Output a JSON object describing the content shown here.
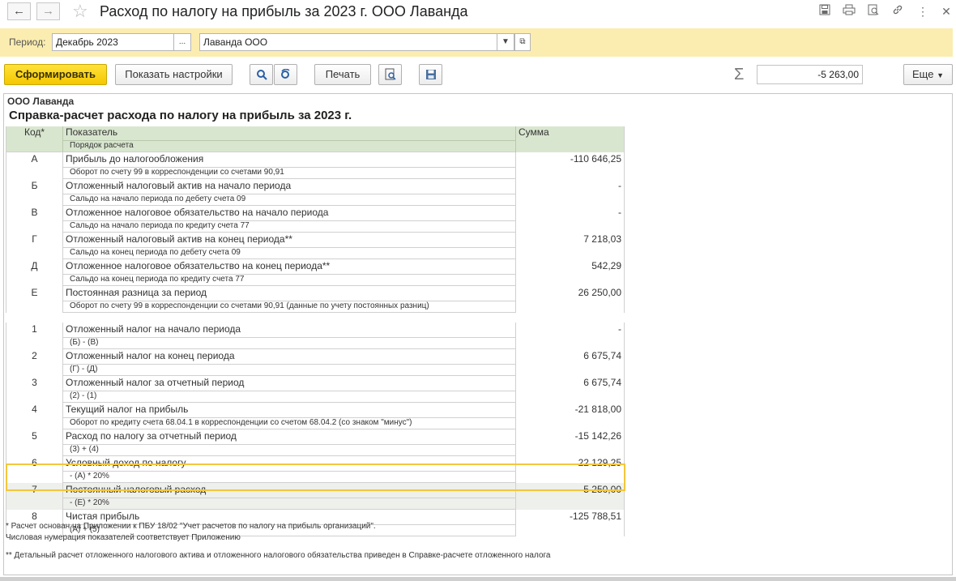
{
  "window": {
    "title": "Расход по налогу на прибыль за 2023 г. ООО Лаванда",
    "back_icon": "arrow-left-icon",
    "forward_icon": "arrow-right-icon",
    "favorite_icon": "star-icon"
  },
  "filters": {
    "period_label": "Период:",
    "period_value": "Декабрь 2023",
    "period_picker": "...",
    "org_value": "Лаванда ООО"
  },
  "toolbar": {
    "generate_label": "Сформировать",
    "settings_label": "Показать настройки",
    "print_label": "Печать",
    "more_label": "Еще",
    "sum_value": "-5 263,00"
  },
  "report": {
    "org": "ООО Лаванда",
    "title": "Справка-расчет расхода по налогу на прибыль за 2023 г.",
    "headers": {
      "code": "Код*",
      "indicator": "Показатель",
      "order": "Порядок расчета",
      "sum": "Сумма"
    },
    "rows": [
      {
        "code": "А",
        "name": "Прибыль до налогообложения",
        "desc": "Оборот по счету 99 в корреспонденции со счетами 90,91",
        "sum": "-110 646,25"
      },
      {
        "code": "Б",
        "name": "Отложенный налоговый актив на начало периода",
        "desc": "Сальдо на начало периода по дебету счета 09",
        "sum": "-"
      },
      {
        "code": "В",
        "name": "Отложенное налоговое обязательство на начало периода",
        "desc": "Сальдо на начало периода по кредиту счета 77",
        "sum": "-"
      },
      {
        "code": "Г",
        "name": "Отложенный налоговый актив на конец периода**",
        "desc": "Сальдо на конец периода по дебету счета 09",
        "sum": "7 218,03"
      },
      {
        "code": "Д",
        "name": "Отложенное налоговое обязательство на конец периода**",
        "desc": "Сальдо на конец периода по кредиту счета  77",
        "sum": "542,29"
      },
      {
        "code": "Е",
        "name": "Постоянная разница за период",
        "desc": "Оборот по счету 99 в корреспонденции со счетами 90,91 (данные по учету постоянных разниц)",
        "sum": "26 250,00"
      }
    ],
    "rows2": [
      {
        "code": "1",
        "name": "Отложенный налог на начало периода",
        "desc": "(Б) - (В)",
        "sum": "-"
      },
      {
        "code": "2",
        "name": "Отложенный налог на конец периода",
        "desc": "(Г) - (Д)",
        "sum": "6 675,74"
      },
      {
        "code": "3",
        "name": "Отложенный налог за отчетный период",
        "desc": "(2) - (1)",
        "sum": "6 675,74"
      },
      {
        "code": "4",
        "name": "Текущий налог на прибыль",
        "desc": "Оборот по кредиту счета 68.04.1 в корреспонденции со счетом 68.04.2 (со знаком \"минус\")",
        "sum": "-21 818,00"
      },
      {
        "code": "5",
        "name": "Расход по налогу за отчетный период",
        "desc": "(3) + (4)",
        "sum": "-15 142,26"
      },
      {
        "code": "6",
        "name": "Условный доход по налогу",
        "desc": "- (А) * 20%",
        "sum": "22 129,25"
      },
      {
        "code": "7",
        "name": "Постоянный налоговый расход",
        "desc": "- (Е) * 20%",
        "sum": "-5 250,00"
      },
      {
        "code": "8",
        "name": "Чистая прибыль",
        "desc": "(А) + (5)",
        "sum": "-125 788,51"
      }
    ],
    "notes": {
      "n1": "* Расчет основан на Приложении к ПБУ 18/02 \"Учет расчетов по налогу на прибыль организаций\".",
      "n2": "Числовая нумерация показателей соответствует Приложению",
      "n3": "** Детальный расчет отложенного налогового актива и отложенного налогового обязательства приведен в Справке-расчете отложенного налога"
    }
  }
}
